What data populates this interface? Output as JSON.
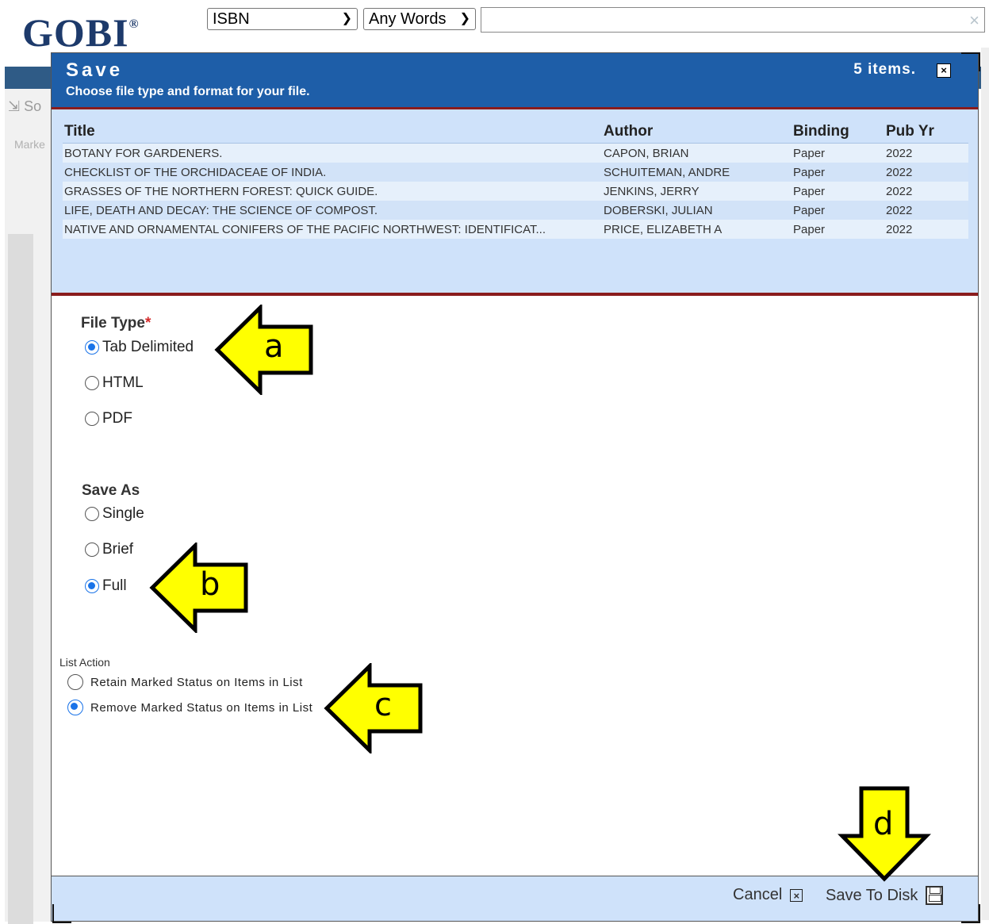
{
  "app": {
    "logo": "GOBI",
    "registered": "®",
    "search_type": "ISBN",
    "word_mode": "Any Words",
    "search_value": "",
    "search_clear": "×",
    "bg_toolbar": "So",
    "bg_marked": "Marke"
  },
  "modal": {
    "title": "Save",
    "subtitle": "Choose file type and format for your file.",
    "item_count": "5 items.",
    "close": "×",
    "columns": [
      "Title",
      "Author",
      "Binding",
      "Pub Yr"
    ],
    "rows": [
      {
        "title": "BOTANY FOR GARDENERS.",
        "author": "CAPON, BRIAN",
        "binding": "Paper",
        "year": "2022"
      },
      {
        "title": "CHECKLIST OF THE ORCHIDACEAE OF INDIA.",
        "author": "SCHUITEMAN, ANDRE",
        "binding": "Paper",
        "year": "2022"
      },
      {
        "title": "GRASSES OF THE NORTHERN FOREST: QUICK GUIDE.",
        "author": "JENKINS, JERRY",
        "binding": "Paper",
        "year": "2022"
      },
      {
        "title": "LIFE, DEATH AND DECAY: THE SCIENCE OF COMPOST.",
        "author": "DOBERSKI, JULIAN",
        "binding": "Paper",
        "year": "2022"
      },
      {
        "title": "NATIVE AND ORNAMENTAL CONIFERS OF THE PACIFIC NORTHWEST: IDENTIFICAT...",
        "author": "PRICE, ELIZABETH A",
        "binding": "Paper",
        "year": "2022"
      }
    ],
    "file_type": {
      "label": "File Type",
      "required": "*",
      "options": [
        "Tab Delimited",
        "HTML",
        "PDF"
      ],
      "selected": "Tab Delimited"
    },
    "save_as": {
      "label": "Save As",
      "options": [
        "Single",
        "Brief",
        "Full"
      ],
      "selected": "Full"
    },
    "list_action": {
      "label": "List Action",
      "options": [
        "Retain Marked Status on Items in List",
        "Remove Marked Status on Items in List"
      ],
      "selected": "Remove Marked Status on Items in List"
    },
    "footer": {
      "cancel": "Cancel",
      "cancel_icon": "×",
      "save": "Save To Disk"
    }
  },
  "annotations": [
    "a",
    "b",
    "c",
    "d"
  ],
  "colors": {
    "header_blue": "#1e5ea8",
    "accent_red": "#8a1c1c",
    "panel_blue": "#cfe2fa",
    "radio_blue": "#1a73e8",
    "arrow_yellow": "#ffff00"
  }
}
